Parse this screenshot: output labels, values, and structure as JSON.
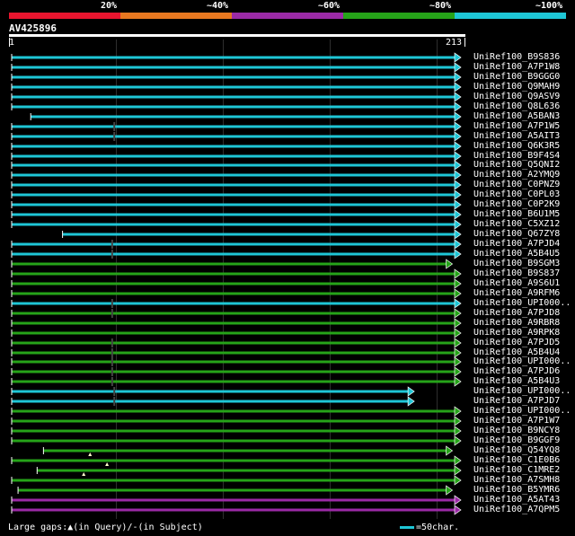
{
  "header": {
    "percent_labels": [
      "20%",
      "~40%",
      "~60%",
      "~80%",
      "~100%"
    ],
    "color_segments": [
      "#e8152e",
      "#e87820",
      "#9b2aa6",
      "#26a319",
      "#1ec6d6"
    ]
  },
  "query": {
    "name": "AV425896",
    "start": "1",
    "end": "213"
  },
  "colors": {
    "cyan": "#1ec6d6",
    "green": "#26a319",
    "purple": "#9b2aa6",
    "gap": "#ffffff"
  },
  "hits": [
    {
      "label": "UniRef100_B9S836",
      "color": "cyan",
      "start": 1,
      "end": 213
    },
    {
      "label": "UniRef100_A7P1W8",
      "color": "cyan",
      "start": 1,
      "end": 213
    },
    {
      "label": "UniRef100_B9GGG0",
      "color": "cyan",
      "start": 1,
      "end": 213
    },
    {
      "label": "UniRef100_Q9MAH9",
      "color": "cyan",
      "start": 1,
      "end": 213
    },
    {
      "label": "UniRef100_Q9ASV9",
      "color": "cyan",
      "start": 1,
      "end": 213
    },
    {
      "label": "UniRef100_Q8L636",
      "color": "cyan",
      "start": 1,
      "end": 213
    },
    {
      "label": "UniRef100_A5BAN3",
      "color": "cyan",
      "start": 10,
      "end": 213
    },
    {
      "label": "UniRef100_A7P1W5",
      "color": "cyan",
      "start": 1,
      "end": 213,
      "gap": 49
    },
    {
      "label": "UniRef100_A5AIT3",
      "color": "cyan",
      "start": 1,
      "end": 213,
      "gap": 49
    },
    {
      "label": "UniRef100_Q6K3R5",
      "color": "cyan",
      "start": 1,
      "end": 213
    },
    {
      "label": "UniRef100_B9F4S4",
      "color": "cyan",
      "start": 1,
      "end": 213
    },
    {
      "label": "UniRef100_Q5QNI2",
      "color": "cyan",
      "start": 1,
      "end": 213
    },
    {
      "label": "UniRef100_A2YMQ9",
      "color": "cyan",
      "start": 1,
      "end": 213
    },
    {
      "label": "UniRef100_C0PNZ9",
      "color": "cyan",
      "start": 1,
      "end": 213
    },
    {
      "label": "UniRef100_C0PL03",
      "color": "cyan",
      "start": 1,
      "end": 213
    },
    {
      "label": "UniRef100_C0P2K9",
      "color": "cyan",
      "start": 1,
      "end": 213
    },
    {
      "label": "UniRef100_B6U1M5",
      "color": "cyan",
      "start": 1,
      "end": 213
    },
    {
      "label": "UniRef100_C5XZ12",
      "color": "cyan",
      "start": 1,
      "end": 213
    },
    {
      "label": "UniRef100_Q67ZY8",
      "color": "cyan",
      "start": 25,
      "end": 213
    },
    {
      "label": "UniRef100_A7PJD4",
      "color": "cyan",
      "start": 1,
      "end": 213,
      "gap": 48
    },
    {
      "label": "UniRef100_A5B4U5",
      "color": "cyan",
      "start": 1,
      "end": 213,
      "gap": 48
    },
    {
      "label": "UniRef100_B9SGM3",
      "color": "green",
      "start": 1,
      "end": 209
    },
    {
      "label": "UniRef100_B9S837",
      "color": "green",
      "start": 1,
      "end": 213
    },
    {
      "label": "UniRef100_A9S6U1",
      "color": "green",
      "start": 1,
      "end": 213
    },
    {
      "label": "UniRef100_A9RFM6",
      "color": "green",
      "start": 1,
      "end": 213
    },
    {
      "label": "UniRef100_UPI000..",
      "color": "cyan",
      "start": 1,
      "end": 213,
      "gap": 48
    },
    {
      "label": "UniRef100_A7PJD8",
      "color": "green",
      "start": 1,
      "end": 213,
      "gap": 48
    },
    {
      "label": "UniRef100_A9RBR8",
      "color": "green",
      "start": 1,
      "end": 213
    },
    {
      "label": "UniRef100_A9RPK8",
      "color": "green",
      "start": 1,
      "end": 213
    },
    {
      "label": "UniRef100_A7PJD5",
      "color": "green",
      "start": 1,
      "end": 213,
      "gap": 48
    },
    {
      "label": "UniRef100_A5B4U4",
      "color": "green",
      "start": 1,
      "end": 213,
      "gap": 48
    },
    {
      "label": "UniRef100_UPI000..",
      "color": "green",
      "start": 1,
      "end": 213,
      "gap": 48
    },
    {
      "label": "UniRef100_A7PJD6",
      "color": "green",
      "start": 1,
      "end": 213,
      "gap": 48
    },
    {
      "label": "UniRef100_A5B4U3",
      "color": "green",
      "start": 1,
      "end": 213,
      "gap": 48
    },
    {
      "label": "UniRef100_UPI000..",
      "color": "cyan",
      "start": 1,
      "end": 191,
      "gap": 49
    },
    {
      "label": "UniRef100_A7PJD7",
      "color": "cyan",
      "start": 1,
      "end": 191,
      "gap": 49
    },
    {
      "label": "UniRef100_UPI000..",
      "color": "green",
      "start": 1,
      "end": 213
    },
    {
      "label": "UniRef100_A7P1W7",
      "color": "green",
      "start": 1,
      "end": 213
    },
    {
      "label": "UniRef100_B9NCY8",
      "color": "green",
      "start": 1,
      "end": 213
    },
    {
      "label": "UniRef100_B9GGF9",
      "color": "green",
      "start": 1,
      "end": 213
    },
    {
      "label": "UniRef100_Q54YQ8",
      "color": "green",
      "start": 16,
      "end": 209
    },
    {
      "label": "UniRef100_C1E0B6",
      "color": "green",
      "start": 1,
      "end": 213,
      "qgap": 38
    },
    {
      "label": "UniRef100_C1MRE2",
      "color": "green",
      "start": 13,
      "end": 213,
      "qgap": 46
    },
    {
      "label": "UniRef100_A7SMH8",
      "color": "green",
      "start": 1,
      "end": 213,
      "qgap": 35
    },
    {
      "label": "UniRef100_B5YMR6",
      "color": "green",
      "start": 4,
      "end": 209
    },
    {
      "label": "UniRef100_A5AT43",
      "color": "purple",
      "start": 1,
      "end": 213
    },
    {
      "label": "UniRef100_A7QPM5",
      "color": "purple",
      "start": 1,
      "end": 213
    }
  ],
  "footer": {
    "gaps_text": "Large gaps:▲(in Query)/-(in Subject)",
    "scale_text": "=50char."
  }
}
